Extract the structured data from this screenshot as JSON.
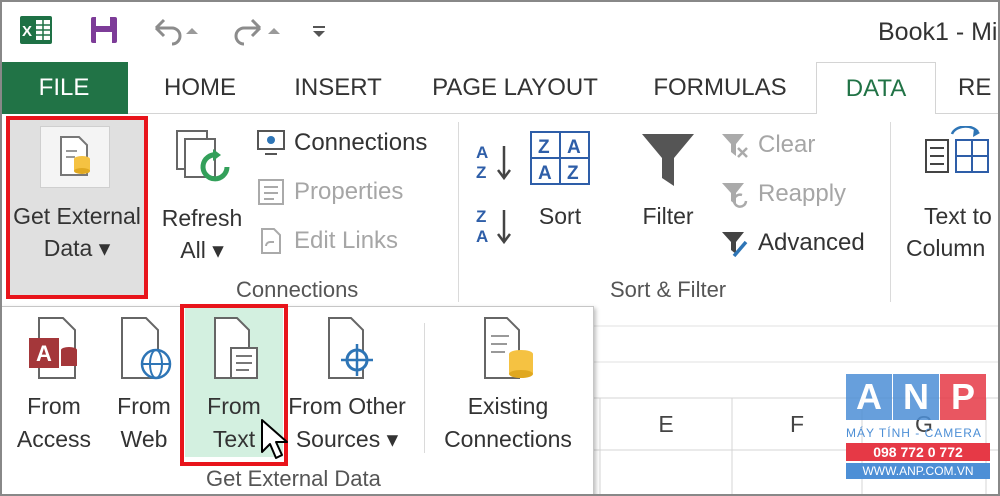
{
  "window": {
    "title": "Book1 - Mi"
  },
  "quick_access": {
    "icons": [
      "excel-logo-icon",
      "save-icon",
      "undo-icon",
      "redo-icon",
      "customize-icon"
    ]
  },
  "tabs": [
    {
      "label": "FILE",
      "active": false
    },
    {
      "label": "HOME",
      "active": false
    },
    {
      "label": "INSERT",
      "active": false
    },
    {
      "label": "PAGE LAYOUT",
      "active": false
    },
    {
      "label": "FORMULAS",
      "active": false
    },
    {
      "label": "DATA",
      "active": true
    },
    {
      "label": "RE",
      "active": false
    }
  ],
  "ribbon": {
    "get_external": {
      "line1": "Get External",
      "line2": "Data ▾"
    },
    "connections_group": {
      "refresh_line1": "Refresh",
      "refresh_line2": "All ▾",
      "connections": "Connections",
      "properties": "Properties",
      "edit_links": "Edit Links",
      "label": "Connections"
    },
    "sort_filter_group": {
      "sort": "Sort",
      "filter": "Filter",
      "clear": "Clear",
      "reapply": "Reapply",
      "advanced": "Advanced",
      "label": "Sort & Filter"
    },
    "data_tools": {
      "text_to_line1": "Text to",
      "text_to_line2": "Column"
    }
  },
  "dropdown": {
    "items": [
      {
        "line1": "From",
        "line2": "Access"
      },
      {
        "line1": "From",
        "line2": "Web"
      },
      {
        "line1": "From",
        "line2": "Text"
      },
      {
        "line1": "From Other",
        "line2": "Sources ▾"
      },
      {
        "line1": "Existing",
        "line2": "Connections"
      }
    ],
    "group_label": "Get External Data"
  },
  "sheet": {
    "columns": [
      "E",
      "F",
      "G"
    ]
  },
  "watermark": {
    "letters": [
      "A",
      "N",
      "P"
    ],
    "tagline": "MÁY TÍNH - CAMERA",
    "phone": "098 772 0 772",
    "site": "WWW.ANP.COM.VN"
  },
  "colors": {
    "excel_green": "#217346",
    "highlight_red": "#e8141b",
    "selected_green": "#d3f0e0",
    "watermark_blue": "#4d8fd6",
    "watermark_red": "#e63946"
  }
}
